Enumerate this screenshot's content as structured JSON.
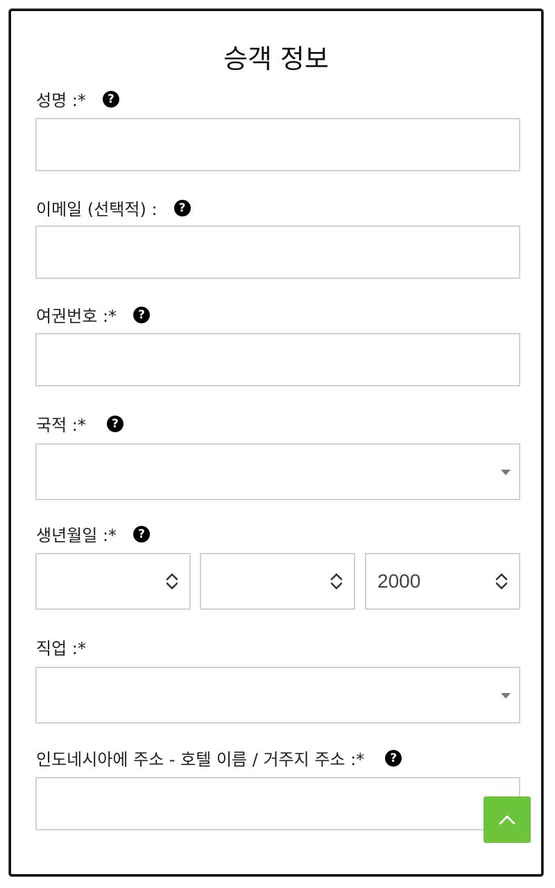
{
  "header": {
    "title": "승객 정보"
  },
  "form": {
    "full_name": {
      "label": "성명 :*",
      "value": ""
    },
    "email": {
      "label": "이메일 (선택적) :",
      "value": ""
    },
    "passport": {
      "label": "여권번호 :*",
      "value": ""
    },
    "nationality": {
      "label": "국적 :*",
      "value": ""
    },
    "birth_date": {
      "label": "생년월일 :*",
      "day": "",
      "month": "",
      "year": "2000"
    },
    "occupation": {
      "label": "직업 :*",
      "value": ""
    },
    "address": {
      "label": "인도네시아에 주소 - 호텔 이름 / 거주지 주소 :*",
      "value": ""
    }
  },
  "help_icon": "?",
  "colors": {
    "accent": "#6cc43a",
    "border": "#d2d2d2"
  },
  "icons": {
    "help": "question-circle-icon",
    "select": "caret-down-icon",
    "stepper": "chevron-up-down-icon",
    "scroll_top": "chevron-up-icon"
  }
}
